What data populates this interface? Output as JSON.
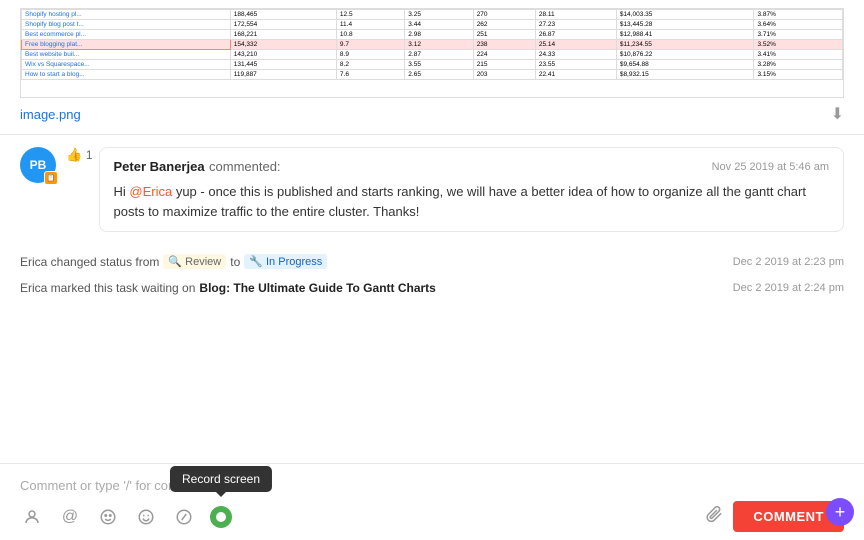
{
  "image": {
    "filename": "image.png",
    "download_icon": "⬇"
  },
  "comment": {
    "avatar_initials": "PB",
    "avatar_badge": "📋",
    "commenter_name": "Peter Banerjea",
    "action_text": "commented:",
    "timestamp": "Nov 25 2019 at 5:46 am",
    "like_count": "1",
    "text_before_mention": "Hi ",
    "mention": "@Erica",
    "text_after_mention": " yup - once this is published and starts ranking, we will have a better idea of how to organize all the gantt chart posts to maximize traffic to the entire cluster. Thanks!"
  },
  "activities": [
    {
      "actor": "Erica",
      "action": "changed status from",
      "from_status": "Review",
      "from_icon": "🔍",
      "from_color": "review",
      "to_text": "to",
      "to_status": "In Progress",
      "to_icon": "🔧",
      "to_color": "inprogress",
      "timestamp": "Dec 2 2019 at 2:23 pm"
    },
    {
      "actor": "Erica",
      "action": "marked this task waiting on",
      "link_text": "Blog: The Ultimate Guide To Gantt Charts",
      "timestamp": "Dec 2 2019 at 2:24 pm"
    }
  ],
  "comment_input": {
    "placeholder": "Comment or type '/' for commands",
    "submit_label": "COMMENT"
  },
  "toolbar": {
    "icons": [
      {
        "name": "person-icon",
        "symbol": "👤"
      },
      {
        "name": "at-icon",
        "symbol": "@"
      },
      {
        "name": "emoji-smile-icon",
        "symbol": "🙂"
      },
      {
        "name": "emoji-icon",
        "symbol": "😊"
      },
      {
        "name": "slash-icon",
        "symbol": "/"
      },
      {
        "name": "screen-record-icon",
        "symbol": ""
      }
    ],
    "attach_icon": "📎"
  },
  "tooltip": {
    "text": "Record screen"
  },
  "plus_button": "+"
}
